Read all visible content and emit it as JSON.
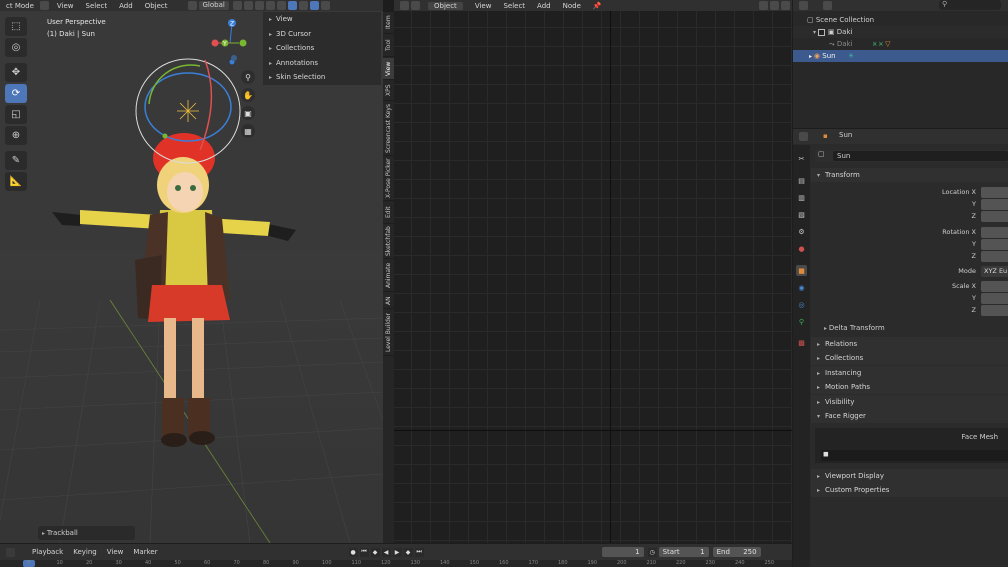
{
  "viewport": {
    "mode": "ct Mode",
    "menu": [
      "View",
      "Select",
      "Add",
      "Object"
    ],
    "transform_orientation": "Global",
    "overlay_title": "User Perspective",
    "overlay_sub": "(1) Daki | Sun",
    "last_operator": "Trackball",
    "npanel_items": [
      "View",
      "3D Cursor",
      "Collections",
      "Annotations",
      "Skin Selection"
    ],
    "side_tabs": [
      "Item",
      "Tool",
      "View",
      "XPS",
      "Screencast Keys",
      "X-Pose Picker",
      "Edit",
      "Sketchfab",
      "Animate",
      "AN",
      "Level Builder"
    ],
    "active_side_tab": "View",
    "gizmo_axes": {
      "z": "Z",
      "y": "Y"
    },
    "tools": [
      "select",
      "cursor",
      "move",
      "rotate",
      "scale",
      "transform",
      "annotate",
      "measure"
    ]
  },
  "node_editor": {
    "mode": "Object",
    "menu": [
      "View",
      "Select",
      "Add",
      "Node"
    ]
  },
  "outliner": {
    "root": "Scene Collection",
    "rows": [
      {
        "name": "Daki",
        "level": 1
      },
      {
        "name": "Daki",
        "level": 2
      },
      {
        "name": "Sun",
        "level": 1,
        "selected": true
      }
    ]
  },
  "properties": {
    "header_object": "Sun",
    "object_name": "Sun",
    "transform_title": "Transform",
    "location_labels": [
      "Location X",
      "Y",
      "Z"
    ],
    "rotation_labels": [
      "Rotation X",
      "Y",
      "Z"
    ],
    "mode_label": "Mode",
    "mode_value": "XYZ Eu",
    "scale_labels": [
      "Scale X",
      "Y",
      "Z"
    ],
    "delta_transform": "Delta Transform",
    "panels": [
      "Relations",
      "Collections",
      "Instancing",
      "Motion Paths",
      "Visibility",
      "Face Rigger"
    ],
    "face_mesh_label": "Face Mesh",
    "panels_bottom": [
      "Viewport Display",
      "Custom Properties"
    ]
  },
  "timeline": {
    "menu": [
      "Playback",
      "Keying",
      "View",
      "Marker"
    ],
    "current_frame": "1",
    "start_label": "Start",
    "start_value": "1",
    "end_label": "End",
    "end_value": "250",
    "ruler_ticks": [
      "0",
      "10",
      "20",
      "30",
      "40",
      "50",
      "60",
      "70",
      "80",
      "90",
      "100",
      "110",
      "120",
      "130",
      "140",
      "150",
      "160",
      "170",
      "180",
      "190",
      "200",
      "210",
      "220",
      "230",
      "240",
      "250"
    ]
  },
  "colors": {
    "accent_blue": "#4d77b8",
    "selection_blue": "#3c5a8d",
    "axis_x": "#e05050",
    "axis_y": "#78b830",
    "axis_z": "#3a7fd8"
  }
}
